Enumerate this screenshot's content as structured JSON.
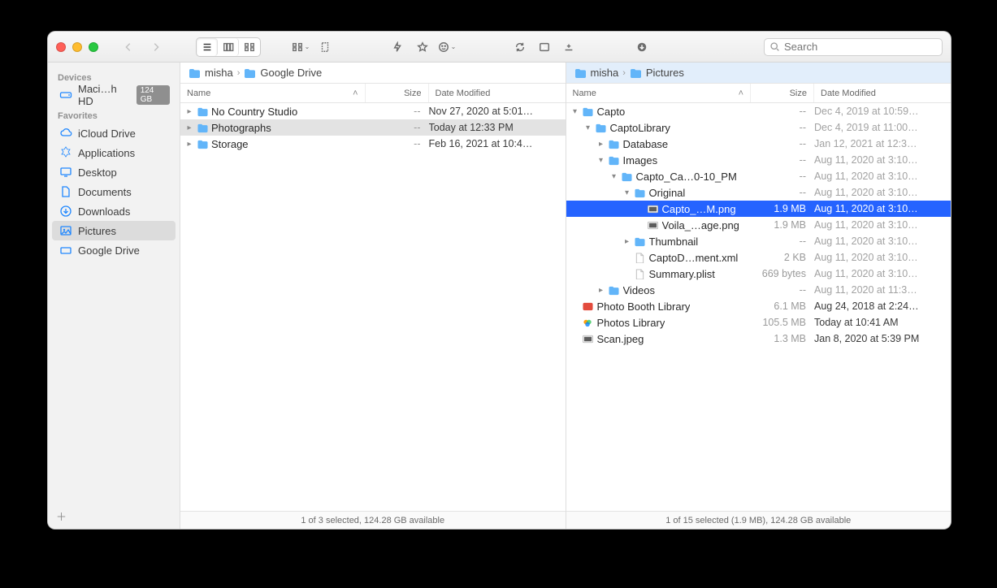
{
  "toolbar": {
    "search_placeholder": "Search"
  },
  "sidebar": {
    "sections": [
      {
        "title": "Devices",
        "items": [
          {
            "label": "Maci…h HD",
            "icon": "hdd",
            "badge": "124 GB"
          }
        ]
      },
      {
        "title": "Favorites",
        "items": [
          {
            "label": "iCloud Drive",
            "icon": "cloud"
          },
          {
            "label": "Applications",
            "icon": "app"
          },
          {
            "label": "Desktop",
            "icon": "desktop"
          },
          {
            "label": "Documents",
            "icon": "doc"
          },
          {
            "label": "Downloads",
            "icon": "download"
          },
          {
            "label": "Pictures",
            "icon": "image",
            "selected": true
          },
          {
            "label": "Google Drive",
            "icon": "gdrive"
          }
        ]
      }
    ]
  },
  "panes": [
    {
      "crumbs": [
        "misha",
        "Google Drive"
      ],
      "columns": {
        "name": "Name",
        "size": "Size",
        "date": "Date Modified"
      },
      "rows": [
        {
          "indent": 0,
          "disc": "closed",
          "type": "folder",
          "name": "No Country Studio",
          "size": "--",
          "date": "Nov 27, 2020 at 5:01…"
        },
        {
          "indent": 0,
          "disc": "closed",
          "type": "folder",
          "name": "Photographs",
          "size": "--",
          "date": "Today at 12:33 PM",
          "selected": true
        },
        {
          "indent": 0,
          "disc": "closed",
          "type": "folder",
          "name": "Storage",
          "size": "--",
          "date": "Feb 16, 2021 at 10:4…"
        }
      ],
      "status": "1 of 3 selected, 124.28 GB available"
    },
    {
      "crumbs": [
        "misha",
        "Pictures"
      ],
      "columns": {
        "name": "Name",
        "size": "Size",
        "date": "Date Modified"
      },
      "rows": [
        {
          "indent": 0,
          "disc": "open",
          "type": "folder",
          "name": "Capto",
          "size": "--",
          "date": "Dec 4, 2019 at 10:59…",
          "grey": true
        },
        {
          "indent": 1,
          "disc": "open",
          "type": "folder",
          "name": "CaptoLibrary",
          "size": "--",
          "date": "Dec 4, 2019 at 11:00…",
          "grey": true
        },
        {
          "indent": 2,
          "disc": "closed",
          "type": "folder",
          "name": "Database",
          "size": "--",
          "date": "Jan 12, 2021 at 12:3…",
          "grey": true
        },
        {
          "indent": 2,
          "disc": "open",
          "type": "folder",
          "name": "Images",
          "size": "--",
          "date": "Aug 11, 2020 at 3:10…",
          "grey": true
        },
        {
          "indent": 3,
          "disc": "open",
          "type": "folder",
          "name": "Capto_Ca…0-10_PM",
          "size": "--",
          "date": "Aug 11, 2020 at 3:10…",
          "grey": true
        },
        {
          "indent": 4,
          "disc": "open",
          "type": "folder",
          "name": "Original",
          "size": "--",
          "date": "Aug 11, 2020 at 3:10…",
          "grey": true
        },
        {
          "indent": 5,
          "disc": "none",
          "type": "img",
          "name": "Capto_…M.png",
          "size": "1.9 MB",
          "date": "Aug 11, 2020 at 3:10…",
          "selected": true
        },
        {
          "indent": 5,
          "disc": "none",
          "type": "img",
          "name": "Voila_…age.png",
          "size": "1.9 MB",
          "date": "Aug 11, 2020 at 3:10…",
          "grey": true
        },
        {
          "indent": 4,
          "disc": "closed",
          "type": "folder",
          "name": "Thumbnail",
          "size": "--",
          "date": "Aug 11, 2020 at 3:10…",
          "grey": true
        },
        {
          "indent": 4,
          "disc": "none",
          "type": "file",
          "name": "CaptoD…ment.xml",
          "size": "2 KB",
          "date": "Aug 11, 2020 at 3:10…",
          "grey": true
        },
        {
          "indent": 4,
          "disc": "none",
          "type": "file",
          "name": "Summary.plist",
          "size": "669 bytes",
          "date": "Aug 11, 2020 at 3:10…",
          "grey": true
        },
        {
          "indent": 2,
          "disc": "closed",
          "type": "folder",
          "name": "Videos",
          "size": "--",
          "date": "Aug 11, 2020 at 11:3…",
          "grey": true
        },
        {
          "indent": 0,
          "disc": "none",
          "type": "photobooth",
          "name": "Photo Booth Library",
          "size": "6.1 MB",
          "date": "Aug 24, 2018 at 2:24…"
        },
        {
          "indent": 0,
          "disc": "none",
          "type": "photos",
          "name": "Photos Library",
          "size": "105.5 MB",
          "date": "Today at 10:41 AM"
        },
        {
          "indent": 0,
          "disc": "none",
          "type": "img",
          "name": "Scan.jpeg",
          "size": "1.3 MB",
          "date": "Jan 8, 2020 at 5:39 PM"
        }
      ],
      "status": "1 of 15 selected (1.9 MB), 124.28 GB available"
    }
  ]
}
